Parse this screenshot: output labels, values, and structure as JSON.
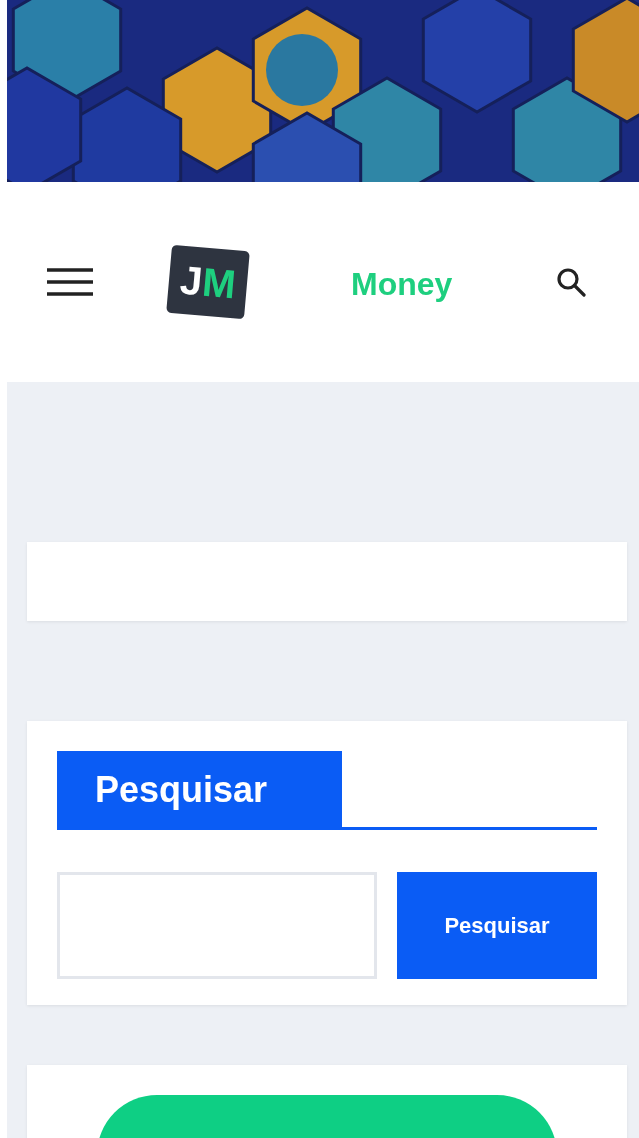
{
  "header": {
    "logo": [
      {
        "text": "J",
        "color": "#ffffff"
      },
      {
        "text": "M",
        "color": "#1ecf7f"
      }
    ],
    "site_name": "Money"
  },
  "search_widget": {
    "title": "Pesquisar",
    "button": "Pesquisar"
  }
}
